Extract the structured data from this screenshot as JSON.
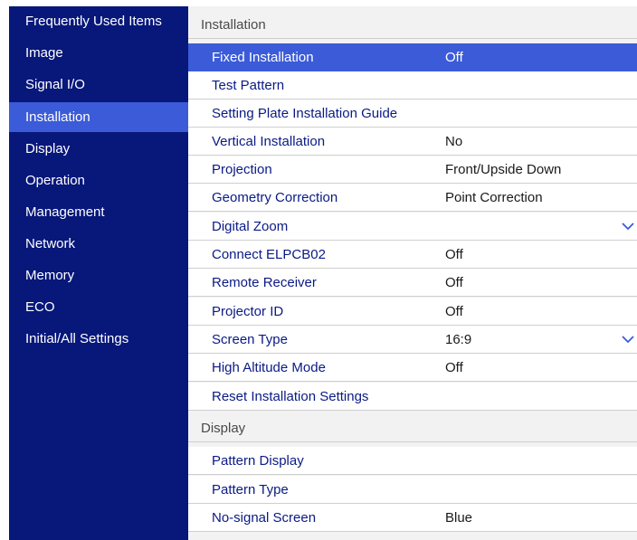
{
  "sidebar": {
    "items": [
      {
        "label": "Frequently Used Items"
      },
      {
        "label": "Image"
      },
      {
        "label": "Signal I/O"
      },
      {
        "label": "Installation"
      },
      {
        "label": "Display"
      },
      {
        "label": "Operation"
      },
      {
        "label": "Management"
      },
      {
        "label": "Network"
      },
      {
        "label": "Memory"
      },
      {
        "label": "ECO"
      },
      {
        "label": "Initial/All Settings"
      }
    ],
    "active": "Installation"
  },
  "main": {
    "installation_header": "Installation",
    "installation_rows": [
      {
        "label": "Fixed Installation",
        "value": "Off"
      },
      {
        "label": "Test Pattern",
        "value": ""
      },
      {
        "label": "Setting Plate Installation Guide",
        "value": ""
      },
      {
        "label": "Vertical Installation",
        "value": "No"
      },
      {
        "label": "Projection",
        "value": "Front/Upside Down"
      },
      {
        "label": "Geometry Correction",
        "value": "Point Correction"
      },
      {
        "label": "Digital Zoom",
        "value": ""
      },
      {
        "label": "Connect ELPCB02",
        "value": "Off"
      },
      {
        "label": "Remote Receiver",
        "value": "Off"
      },
      {
        "label": "Projector ID",
        "value": "Off"
      },
      {
        "label": "Screen Type",
        "value": "16:9"
      },
      {
        "label": "High Altitude Mode",
        "value": "Off"
      },
      {
        "label": "Reset Installation Settings",
        "value": ""
      }
    ],
    "display_header": "Display",
    "display_rows": [
      {
        "label": "Pattern Display",
        "value": ""
      },
      {
        "label": "Pattern Type",
        "value": ""
      },
      {
        "label": "No-signal Screen",
        "value": "Blue"
      }
    ],
    "selected_row": "Fixed Installation"
  },
  "icons": {
    "expand": "chevron-down-icon"
  },
  "colors": {
    "sidebar_bg": "#07177a",
    "highlight": "#3b5bd8",
    "label_text": "#0a1a85",
    "section_bg": "#f2f2f2"
  }
}
